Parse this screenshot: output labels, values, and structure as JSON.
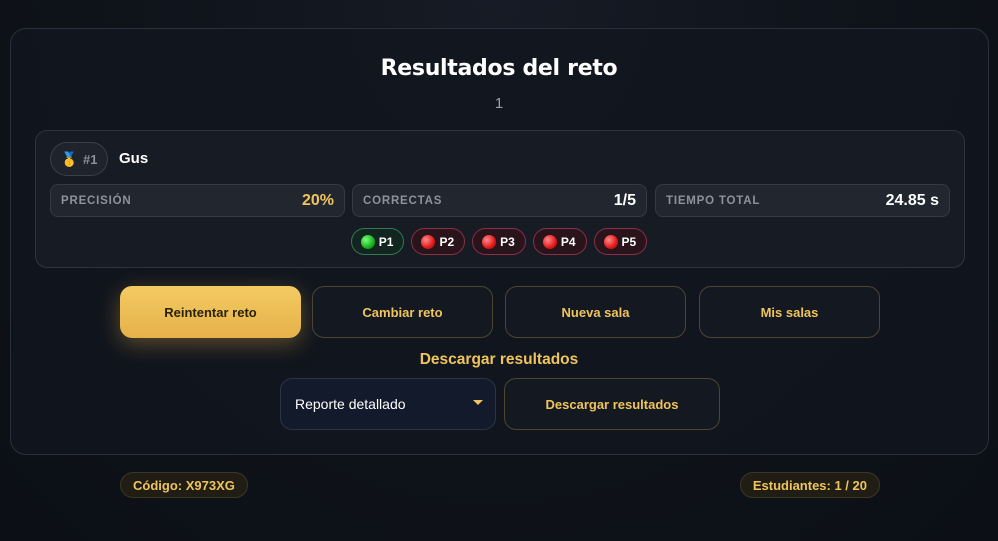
{
  "header": {
    "title": "Resultados del reto",
    "subtitle": "1"
  },
  "result": {
    "medal_icon": "medal-icon",
    "rank": "#1",
    "name": "Gus",
    "stats": [
      {
        "label": "PRECISIÓN",
        "value": "20%"
      },
      {
        "label": "CORRECTAS",
        "value": "1/5"
      },
      {
        "label": "TIEMPO TOTAL",
        "value": "24.85 s"
      }
    ],
    "questions": [
      {
        "label": "P1",
        "correct": true
      },
      {
        "label": "P2",
        "correct": false
      },
      {
        "label": "P3",
        "correct": false
      },
      {
        "label": "P4",
        "correct": false
      },
      {
        "label": "P5",
        "correct": false
      }
    ]
  },
  "actions": {
    "retry": "Reintentar reto",
    "change": "Cambiar reto",
    "new_room": "Nueva sala",
    "my_rooms": "Mis salas"
  },
  "download": {
    "title": "Descargar resultados",
    "report_type": "Reporte detallado",
    "button": "Descargar resultados"
  },
  "footer": {
    "code": "Código: X973XG",
    "students": "Estudiantes: 1 / 20"
  },
  "colors": {
    "accent": "#f0c45c",
    "correct": "#14b01e",
    "incorrect": "#e01818"
  }
}
